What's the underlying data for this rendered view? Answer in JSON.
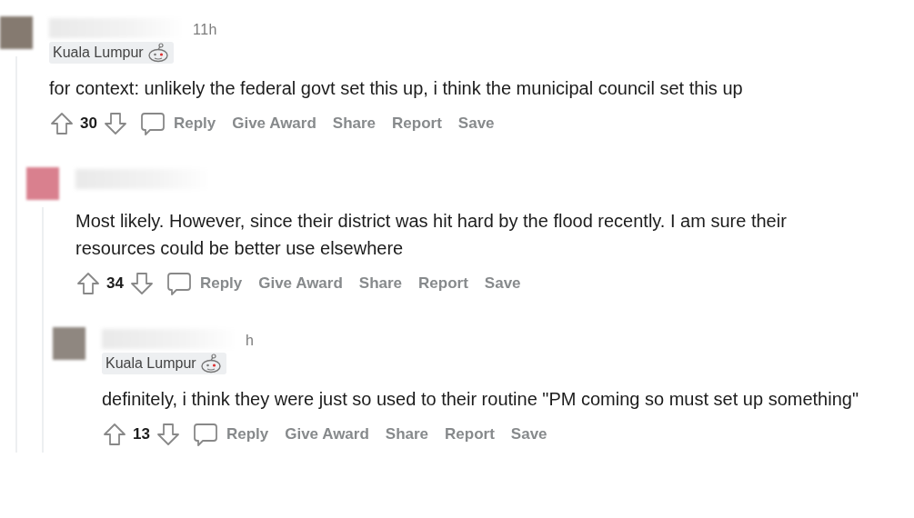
{
  "comments": [
    {
      "color": "#857a70",
      "time": "11h",
      "flair": "Kuala Lumpur",
      "body": "for context: unlikely the federal govt set this up, i think the municipal council set this up",
      "score": "30",
      "actions": [
        "Reply",
        "Give Award",
        "Share",
        "Report",
        "Save"
      ],
      "children": [
        {
          "color": "#d9808e",
          "body": "Most likely. However, since their district was hit hard by the flood recently. I am sure their resources could be better use elsewhere",
          "score": "34",
          "actions": [
            "Reply",
            "Give Award",
            "Share",
            "Report",
            "Save"
          ],
          "children": [
            {
              "color": "#8f8780",
              "time": "h",
              "flair": "Kuala Lumpur",
              "body": "definitely, i think they were just so used to their routine \"PM coming so must set up something\"",
              "score": "13",
              "actions": [
                "Reply",
                "Give Award",
                "Share",
                "Report",
                "Save"
              ]
            }
          ]
        }
      ]
    }
  ]
}
